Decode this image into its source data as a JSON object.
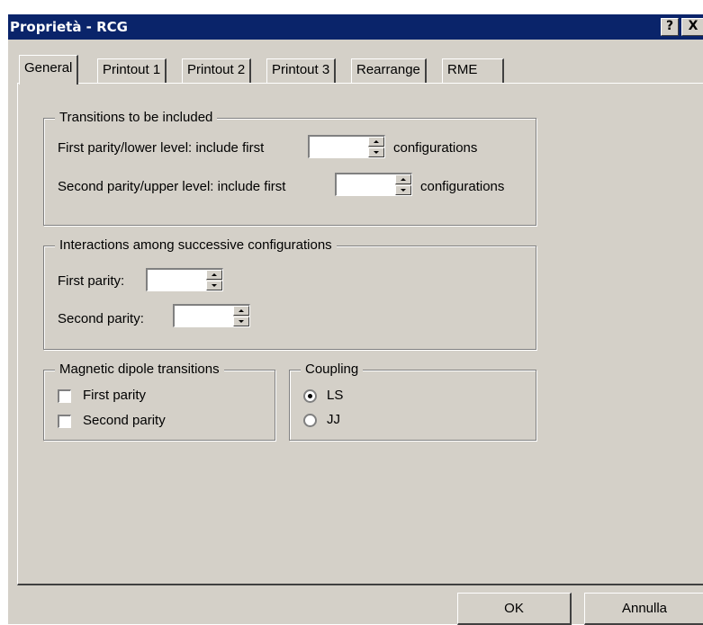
{
  "window": {
    "title": "Proprietà - RCG",
    "help_label": "?",
    "close_label": "X"
  },
  "tabs": [
    {
      "label": "General",
      "active": true
    },
    {
      "label": "Printout 1"
    },
    {
      "label": "Printout 2"
    },
    {
      "label": "Printout 3"
    },
    {
      "label": "Rearrange"
    },
    {
      "label": "RME"
    }
  ],
  "transitions": {
    "title": "Transitions to be included",
    "first_label": "First parity/lower level: include first",
    "first_value": "",
    "first_suffix": "configurations",
    "second_label": "Second parity/upper level: include first",
    "second_value": "",
    "second_suffix": "configurations"
  },
  "interactions": {
    "title": "Interactions among successive configurations",
    "first_label": "First parity:",
    "first_value": "",
    "second_label": "Second parity:",
    "second_value": ""
  },
  "magnetic": {
    "title": "Magnetic dipole transitions",
    "first_label": "First parity",
    "first_checked": false,
    "second_label": "Second parity",
    "second_checked": false
  },
  "coupling": {
    "title": "Coupling",
    "options": [
      {
        "label": "LS",
        "selected": true
      },
      {
        "label": "JJ",
        "selected": false
      }
    ]
  },
  "buttons": {
    "ok_label": "OK",
    "cancel_label": "Annulla"
  },
  "colors": {
    "titlebar": "#0a246a",
    "face": "#d4d0c8"
  }
}
